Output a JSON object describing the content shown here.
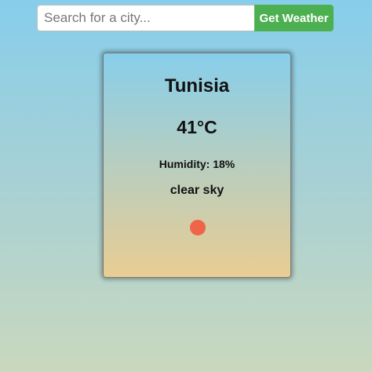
{
  "search": {
    "placeholder": "Search for a city...",
    "value": "",
    "button_label": "Get Weather"
  },
  "weather": {
    "city": "Tunisia",
    "temperature": "41°C",
    "humidity": "Humidity: 18%",
    "description": "clear sky",
    "icon": "sun-icon"
  },
  "colors": {
    "button": "#4caf50",
    "sun": "#f0654a"
  }
}
